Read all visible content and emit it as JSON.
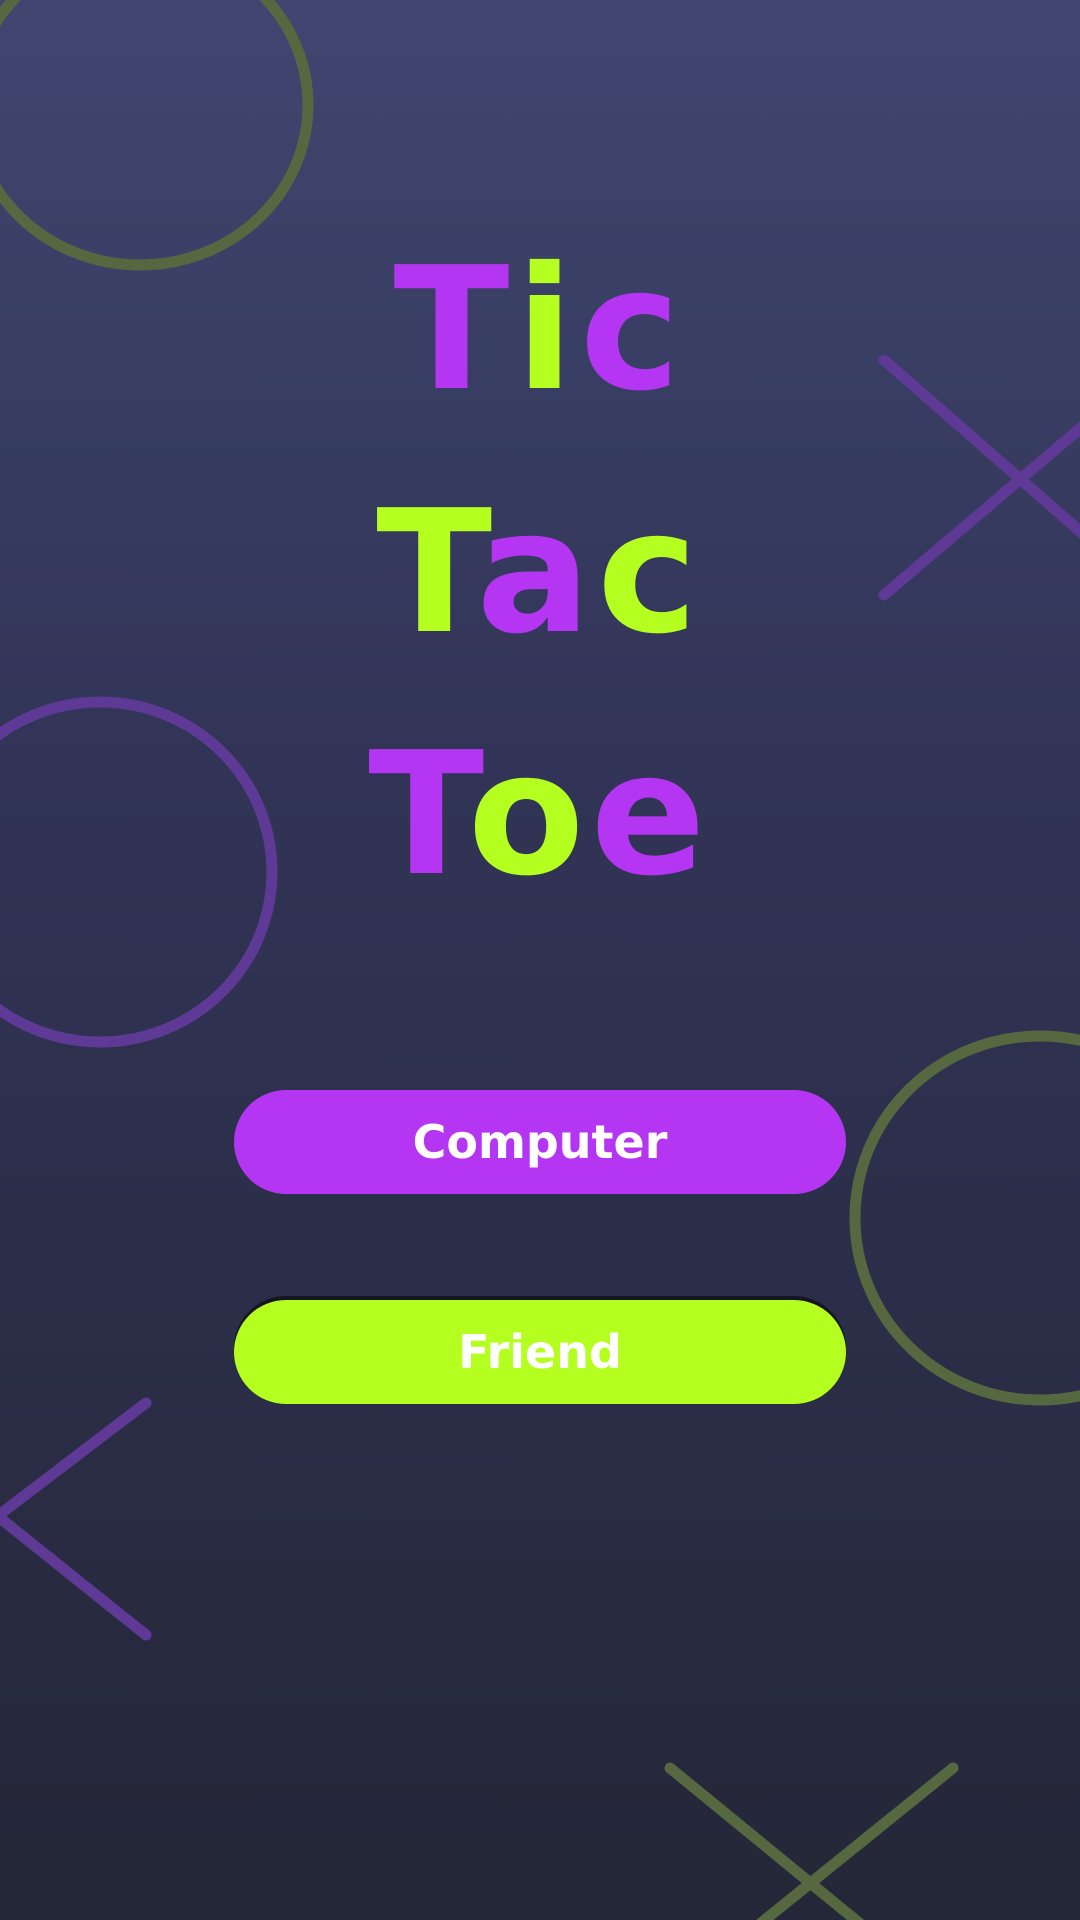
{
  "colors": {
    "background_top": "#404670",
    "background_bottom": "#242737",
    "purple": "#b536f2",
    "green": "#b4ff1f",
    "deco_purple": "#5e3a96",
    "deco_green": "#56683f"
  },
  "title": {
    "lines": [
      {
        "letters": [
          {
            "char": "T",
            "color": "purple"
          },
          {
            "char": "i",
            "color": "green"
          },
          {
            "char": "c",
            "color": "purple"
          }
        ]
      },
      {
        "letters": [
          {
            "char": "T",
            "color": "green"
          },
          {
            "char": "a",
            "color": "purple"
          },
          {
            "char": "c",
            "color": "green"
          }
        ]
      },
      {
        "letters": [
          {
            "char": "T",
            "color": "purple"
          },
          {
            "char": "o",
            "color": "green"
          },
          {
            "char": "e",
            "color": "purple"
          }
        ]
      }
    ]
  },
  "buttons": {
    "computer_label": "Computer",
    "friend_label": "Friend"
  },
  "decorations": [
    {
      "shape": "ring",
      "color": "deco_green"
    },
    {
      "shape": "cross",
      "color": "deco_purple"
    },
    {
      "shape": "ring",
      "color": "deco_purple"
    },
    {
      "shape": "ring",
      "color": "deco_green"
    },
    {
      "shape": "cross",
      "color": "deco_purple"
    },
    {
      "shape": "cross",
      "color": "deco_green"
    }
  ]
}
